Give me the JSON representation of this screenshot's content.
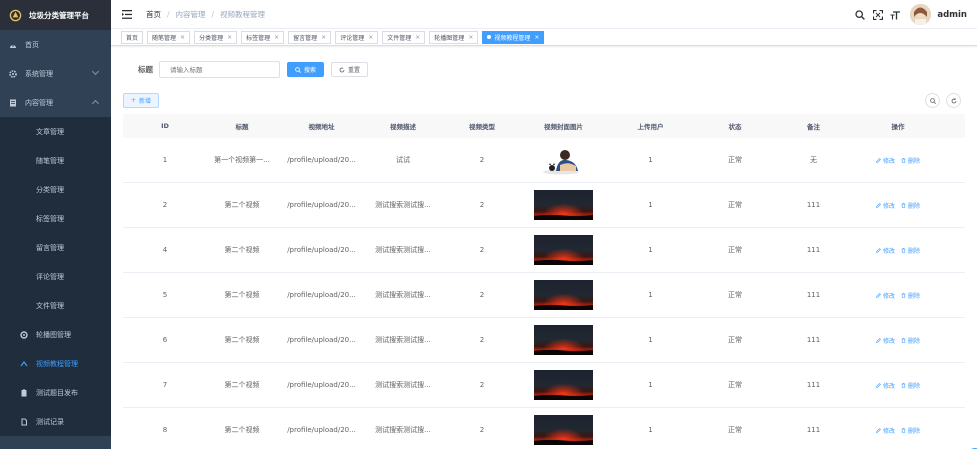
{
  "app": {
    "title": "垃圾分类管理平台"
  },
  "sidebar": {
    "items": [
      {
        "label": "首页",
        "icon": "dashboard-icon"
      },
      {
        "label": "系统管理",
        "icon": "gear-icon"
      },
      {
        "label": "内容管理",
        "icon": "document-icon"
      }
    ],
    "content_children": [
      "文章管理",
      "随笔管理",
      "分类管理",
      "标签管理",
      "留言管理",
      "评论管理",
      "文件管理"
    ],
    "extra": [
      {
        "label": "轮播图管理",
        "icon": "carousel-icon"
      },
      {
        "label": "视频教程管理",
        "icon": "video-icon"
      },
      {
        "label": "测试题目发布",
        "icon": "clipboard-icon"
      },
      {
        "label": "测试记录",
        "icon": "record-icon"
      }
    ]
  },
  "header": {
    "breadcrumb": [
      "首页",
      "内容管理",
      "视频教程管理"
    ],
    "user": "admin"
  },
  "tags": [
    "首页",
    "随笔管理",
    "分类管理",
    "标签管理",
    "留言管理",
    "评论管理",
    "文件管理",
    "轮播图管理",
    "视频教程管理"
  ],
  "search": {
    "label": "标题",
    "placeholder": "请输入标题",
    "search_btn": "搜索",
    "reset_btn": "重置"
  },
  "toolbar": {
    "add_label": "新增"
  },
  "table": {
    "headers": [
      "ID",
      "标题",
      "视频地址",
      "视频描述",
      "视频类型",
      "视频封面图片",
      "上传用户",
      "状态",
      "备注",
      "操作"
    ],
    "edit_label": "修改",
    "delete_label": "删除",
    "rows": [
      {
        "id": "1",
        "title": "第一个视频第一...",
        "url": "/profile/upload/20...",
        "desc": "试试",
        "type": "2",
        "cover": "person",
        "user": "1",
        "status": "正常",
        "note": "无"
      },
      {
        "id": "2",
        "title": "第二个视频",
        "url": "/profile/upload/20...",
        "desc": "测试搜索测试搜...",
        "type": "2",
        "cover": "sunset",
        "user": "1",
        "status": "正常",
        "note": "111"
      },
      {
        "id": "4",
        "title": "第二个视频",
        "url": "/profile/upload/20...",
        "desc": "测试搜索测试搜...",
        "type": "2",
        "cover": "sunset",
        "user": "1",
        "status": "正常",
        "note": "111"
      },
      {
        "id": "5",
        "title": "第二个视频",
        "url": "/profile/upload/20...",
        "desc": "测试搜索测试搜...",
        "type": "2",
        "cover": "sunset",
        "user": "1",
        "status": "正常",
        "note": "111"
      },
      {
        "id": "6",
        "title": "第二个视频",
        "url": "/profile/upload/20...",
        "desc": "测试搜索测试搜...",
        "type": "2",
        "cover": "sunset",
        "user": "1",
        "status": "正常",
        "note": "111"
      },
      {
        "id": "7",
        "title": "第二个视频",
        "url": "/profile/upload/20...",
        "desc": "测试搜索测试搜...",
        "type": "2",
        "cover": "sunset",
        "user": "1",
        "status": "正常",
        "note": "111"
      },
      {
        "id": "8",
        "title": "第二个视频",
        "url": "/profile/upload/20...",
        "desc": "测试搜索测试搜...",
        "type": "2",
        "cover": "sunset",
        "user": "1",
        "status": "正常",
        "note": "111"
      }
    ]
  },
  "colors": {
    "sidebar_bg": "#304156",
    "primary": "#409eff",
    "active_menu": "#409eff"
  }
}
